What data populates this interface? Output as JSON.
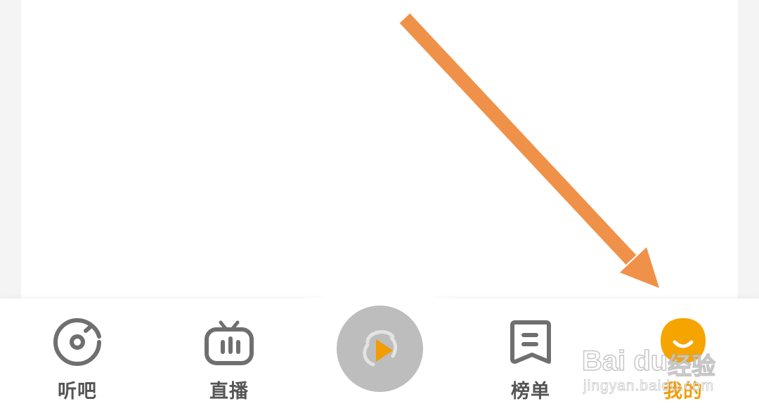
{
  "tabs": [
    {
      "id": "listen",
      "label": "听吧",
      "icon": "music-disc-icon",
      "active": false
    },
    {
      "id": "live",
      "label": "直播",
      "icon": "tv-icon",
      "active": false
    },
    {
      "id": "play",
      "label": "",
      "icon": "play-logo-icon",
      "active": false
    },
    {
      "id": "chart",
      "label": "榜单",
      "icon": "ranking-bookmark-icon",
      "active": false
    },
    {
      "id": "mine",
      "label": "我的",
      "icon": "smiley-avatar-icon",
      "active": true
    }
  ],
  "watermark": {
    "brand": "Bai du",
    "brand_cn": "经验",
    "url": "jingyan.baidu.com"
  },
  "colors": {
    "accent": "#f39c00",
    "icon_gray": "#6f6f6f",
    "center_button": "#bdbdbd",
    "annotation_arrow": "#f0914a"
  }
}
